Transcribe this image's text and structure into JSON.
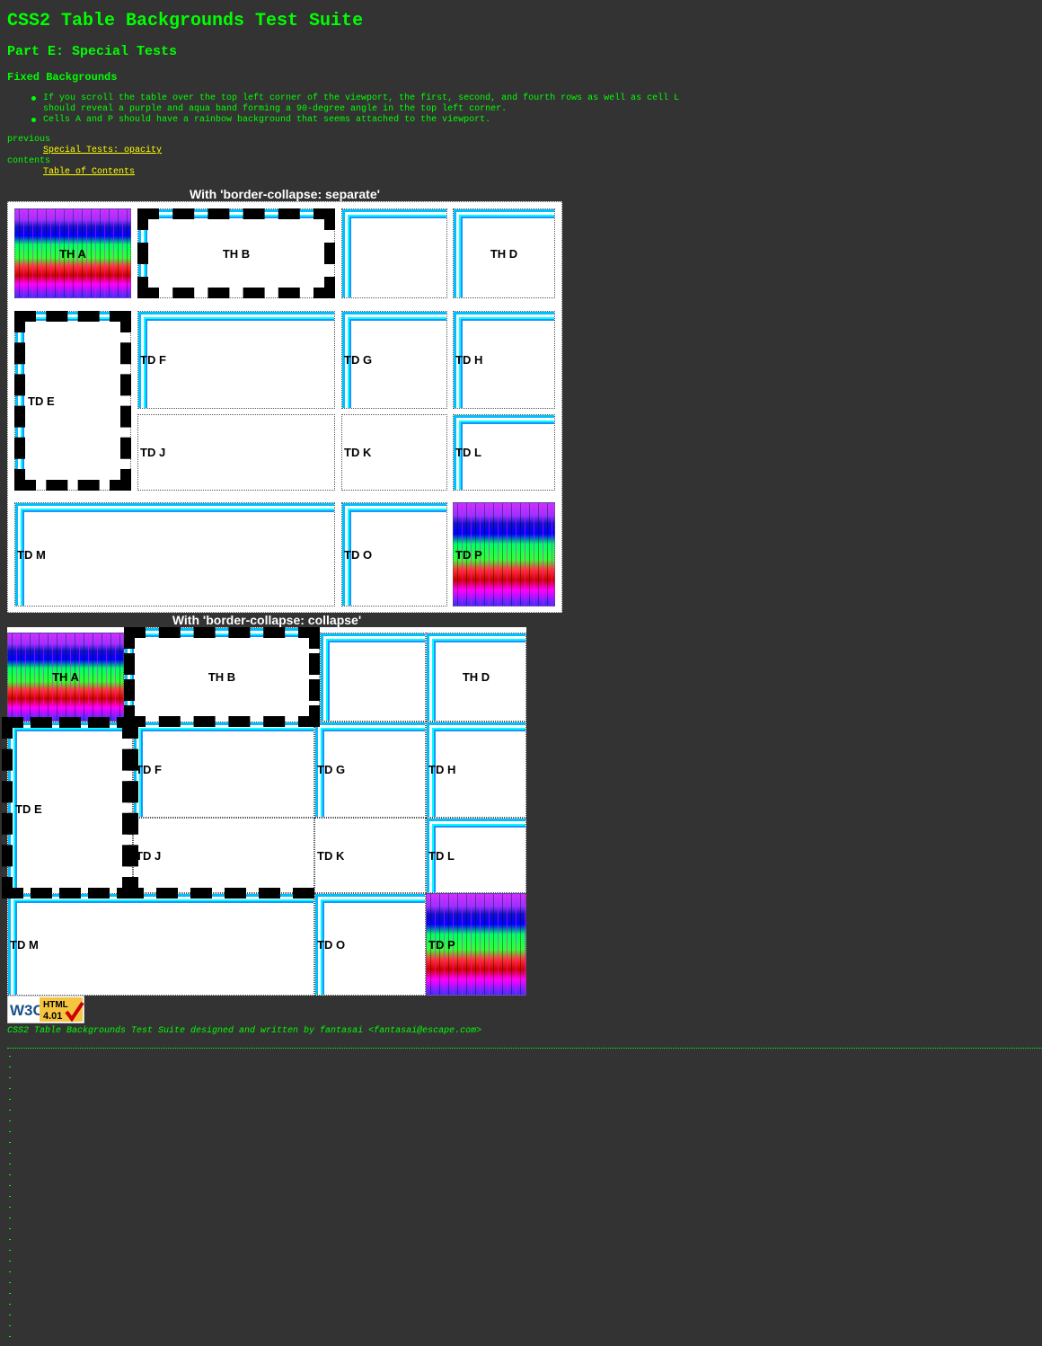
{
  "header": {
    "title": "CSS2 Table Backgrounds Test Suite",
    "part": "Part E: Special Tests",
    "section": "Fixed Backgrounds"
  },
  "notes": [
    "If you scroll the table over the top left corner of the viewport, the first, second, and fourth rows as well as cell L",
    "should reveal a purple and aqua band forming a 90-degree angle in the top left corner.",
    "Cells A and P should have a rainbow background that seems attached to the viewport."
  ],
  "nav": {
    "previous_label": "previous",
    "previous_link": "Special Tests: opacity",
    "contents_label": "contents",
    "contents_link": "Table of Contents"
  },
  "tables": {
    "separate": {
      "caption": "With 'border-collapse: separate'",
      "cells": {
        "a": "TH A",
        "b": "TH B",
        "d": "TH D",
        "e": "TD E",
        "f": "TD F",
        "g": "TD G",
        "h": "TD H",
        "j": "TD J",
        "k": "TD K",
        "l": "TD L",
        "m": "TD M",
        "o": "TD O",
        "p": "TD P"
      }
    },
    "collapse": {
      "caption": "With 'border-collapse: collapse'",
      "cells": {
        "a": "TH A",
        "b": "TH B",
        "d": "TH D",
        "e": "TD E",
        "f": "TD F",
        "g": "TD G",
        "h": "TD H",
        "j": "TD J",
        "k": "TD K",
        "l": "TD L",
        "m": "TD M",
        "o": "TD O",
        "p": "TD P"
      }
    }
  },
  "badge": {
    "w3c": "W3C",
    "html": "HTML",
    "version": "4.01"
  },
  "footer": "CSS2 Table Backgrounds Test Suite designed and written by fantasai <fantasai@escape.com>",
  "colors": {
    "background": "#333333",
    "text": "#00ff00",
    "link": "#ffff00",
    "caption": "#ffffff",
    "band_aqua": "#00ffff",
    "band_blue": "#1e90ff"
  }
}
